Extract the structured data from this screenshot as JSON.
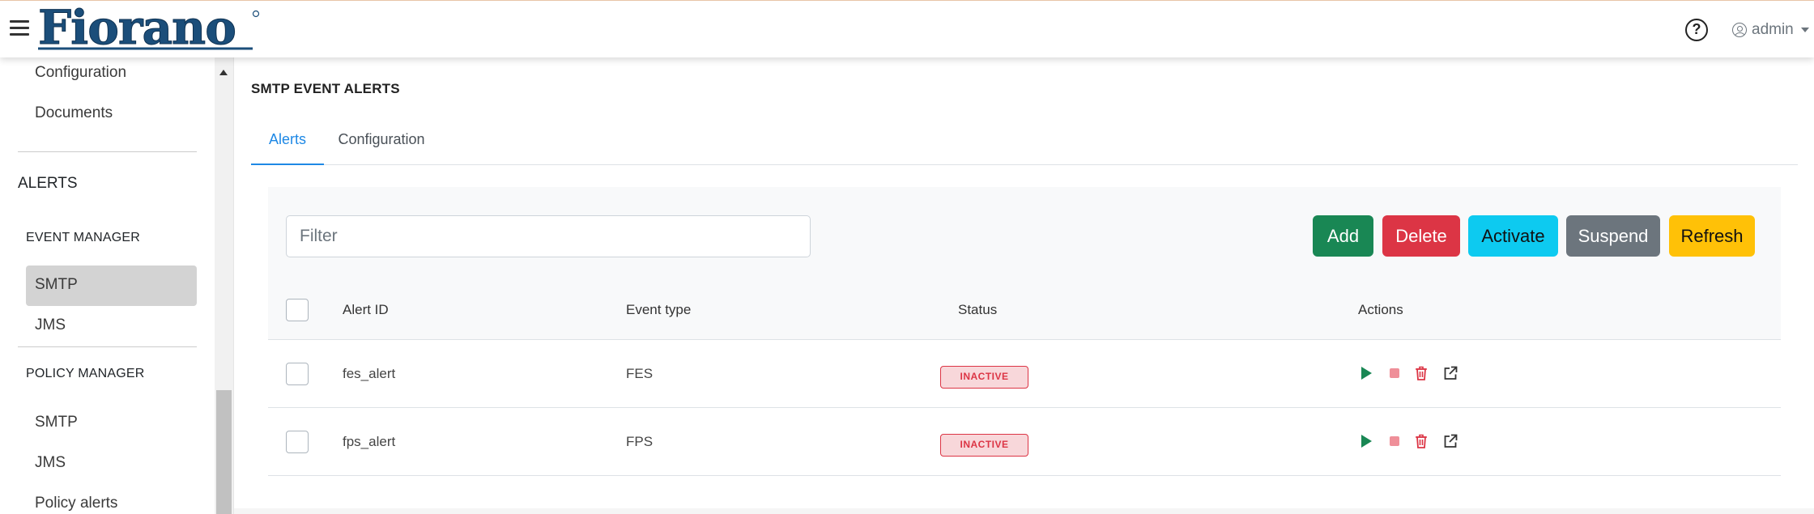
{
  "header": {
    "logo_text": "Fiorano",
    "help_label": "?",
    "user_name": "admin",
    "icons": [
      "hamburger-icon",
      "help-icon",
      "user-circle-icon",
      "chevron-down-icon"
    ]
  },
  "sidebar": {
    "top_items": [
      {
        "label": "Configuration"
      },
      {
        "label": "Documents"
      }
    ],
    "alerts_heading": "ALERTS",
    "event_manager": {
      "heading": "EVENT MANAGER",
      "items": [
        {
          "label": "SMTP",
          "active": true
        },
        {
          "label": "JMS",
          "active": false
        }
      ]
    },
    "policy_manager": {
      "heading": "POLICY MANAGER",
      "items": [
        {
          "label": "SMTP"
        },
        {
          "label": "JMS"
        },
        {
          "label": "Policy alerts"
        }
      ]
    }
  },
  "main": {
    "title": "SMTP EVENT ALERTS",
    "tabs": [
      {
        "label": "Alerts",
        "active": true
      },
      {
        "label": "Configuration",
        "active": false
      }
    ],
    "filter": {
      "placeholder": "Filter",
      "value": ""
    },
    "buttons": {
      "add": "Add",
      "delete": "Delete",
      "activate": "Activate",
      "suspend": "Suspend",
      "refresh": "Refresh"
    },
    "table": {
      "columns": [
        "Alert ID",
        "Event type",
        "Status",
        "Actions"
      ],
      "rows": [
        {
          "alert_id": "fes_alert",
          "event_type": "FES",
          "status": "INACTIVE"
        },
        {
          "alert_id": "fps_alert",
          "event_type": "FPS",
          "status": "INACTIVE"
        }
      ],
      "action_icons": [
        "play-icon",
        "stop-icon",
        "trash-icon",
        "external-link-icon"
      ]
    }
  },
  "colors": {
    "accent": "#1e88e5",
    "logo": "#1b4e7a",
    "add": "#198754",
    "delete": "#dc3545",
    "activate": "#0dcaf0",
    "suspend": "#6c757d",
    "refresh": "#ffc107",
    "inactive_badge_bg": "#f8d7da"
  }
}
